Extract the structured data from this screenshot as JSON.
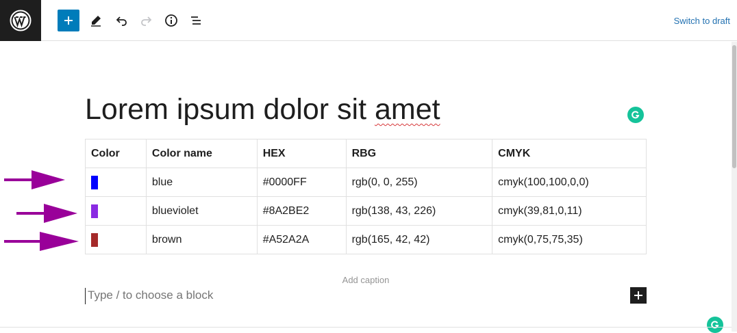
{
  "toolbar": {
    "logo_icon": "wordpress-icon",
    "add_block_icon": "plus-icon",
    "tools_icon": "pencil-icon",
    "undo_icon": "undo-icon",
    "redo_icon": "redo-icon",
    "details_icon": "info-icon",
    "outline_icon": "list-view-icon",
    "switch_to_draft_label": "Switch to draft",
    "accent_color": "#007cba"
  },
  "post": {
    "title_plain": "Lorem ipsum dolor sit ",
    "title_misspelled": "amet"
  },
  "table": {
    "headers": [
      "Color",
      "Color name",
      "HEX",
      "RBG",
      "CMYK"
    ],
    "rows": [
      {
        "swatch": "#0000FF",
        "name": "blue",
        "hex": "#0000FF",
        "rgb": "rgb(0, 0, 255)",
        "cmyk": "cmyk(100,100,0,0)"
      },
      {
        "swatch": "#8A2BE2",
        "name": "blueviolet",
        "hex": "#8A2BE2",
        "rgb": "rgb(138, 43, 226)",
        "cmyk": "cmyk(39,81,0,11)"
      },
      {
        "swatch": "#A52A2A",
        "name": "brown",
        "hex": "#A52A2A",
        "rgb": "rgb(165, 42, 42)",
        "cmyk": "cmyk(0,75,75,35)"
      }
    ],
    "caption_placeholder": "Add caption"
  },
  "annotations": {
    "arrow_color": "#990099"
  },
  "editor": {
    "block_placeholder": "Type / to choose a block",
    "inserter_icon": "plus-icon",
    "grammarly_icon": "grammarly-icon"
  }
}
